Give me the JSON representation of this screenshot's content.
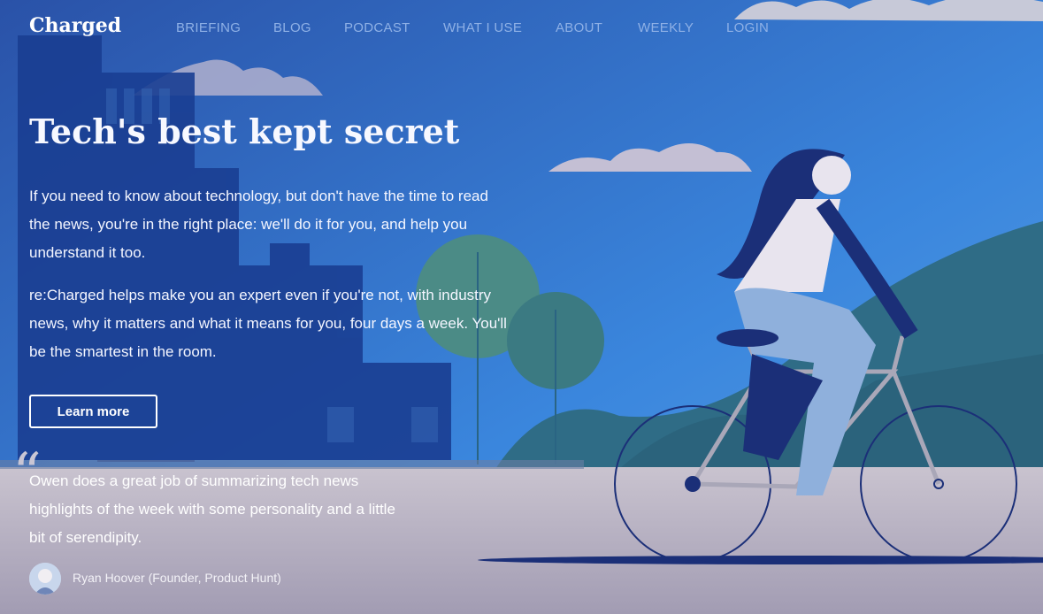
{
  "site": {
    "logo": "Charged"
  },
  "nav": {
    "items": [
      "BRIEFING",
      "BLOG",
      "PODCAST",
      "WHAT I USE",
      "ABOUT",
      "WEEKLY",
      "LOGIN"
    ]
  },
  "hero": {
    "title": "Tech's best kept secret",
    "paragraph1": "If you need to know about technology, but don't have the time to read the news, you're in the right place: we'll do it for you, and help you understand it too.",
    "paragraph2": "re:Charged helps make you an expert even if you're not, with industry news, why it matters and what it means for you, four days a week. You'll be the smartest in the room.",
    "cta_label": "Learn more"
  },
  "testimonial": {
    "quote_mark": "“",
    "text": "Owen does a great job of summarizing tech news highlights of the week with some personality and a little bit of serendipity.",
    "author": "Ryan Hoover (Founder, Product Hunt)"
  },
  "colors": {
    "sky_top": "#1f76d6",
    "sky_bottom": "#3d7fd3",
    "city": "#1a3e92",
    "ground": "#b7b2c3",
    "hill": "#2f6d8a",
    "tree": "#3a7a86",
    "bike": "#1b2f78",
    "nav_text": "#8fb1e6"
  },
  "illustration": {
    "name": "woman-riding-bicycle-illustration"
  }
}
